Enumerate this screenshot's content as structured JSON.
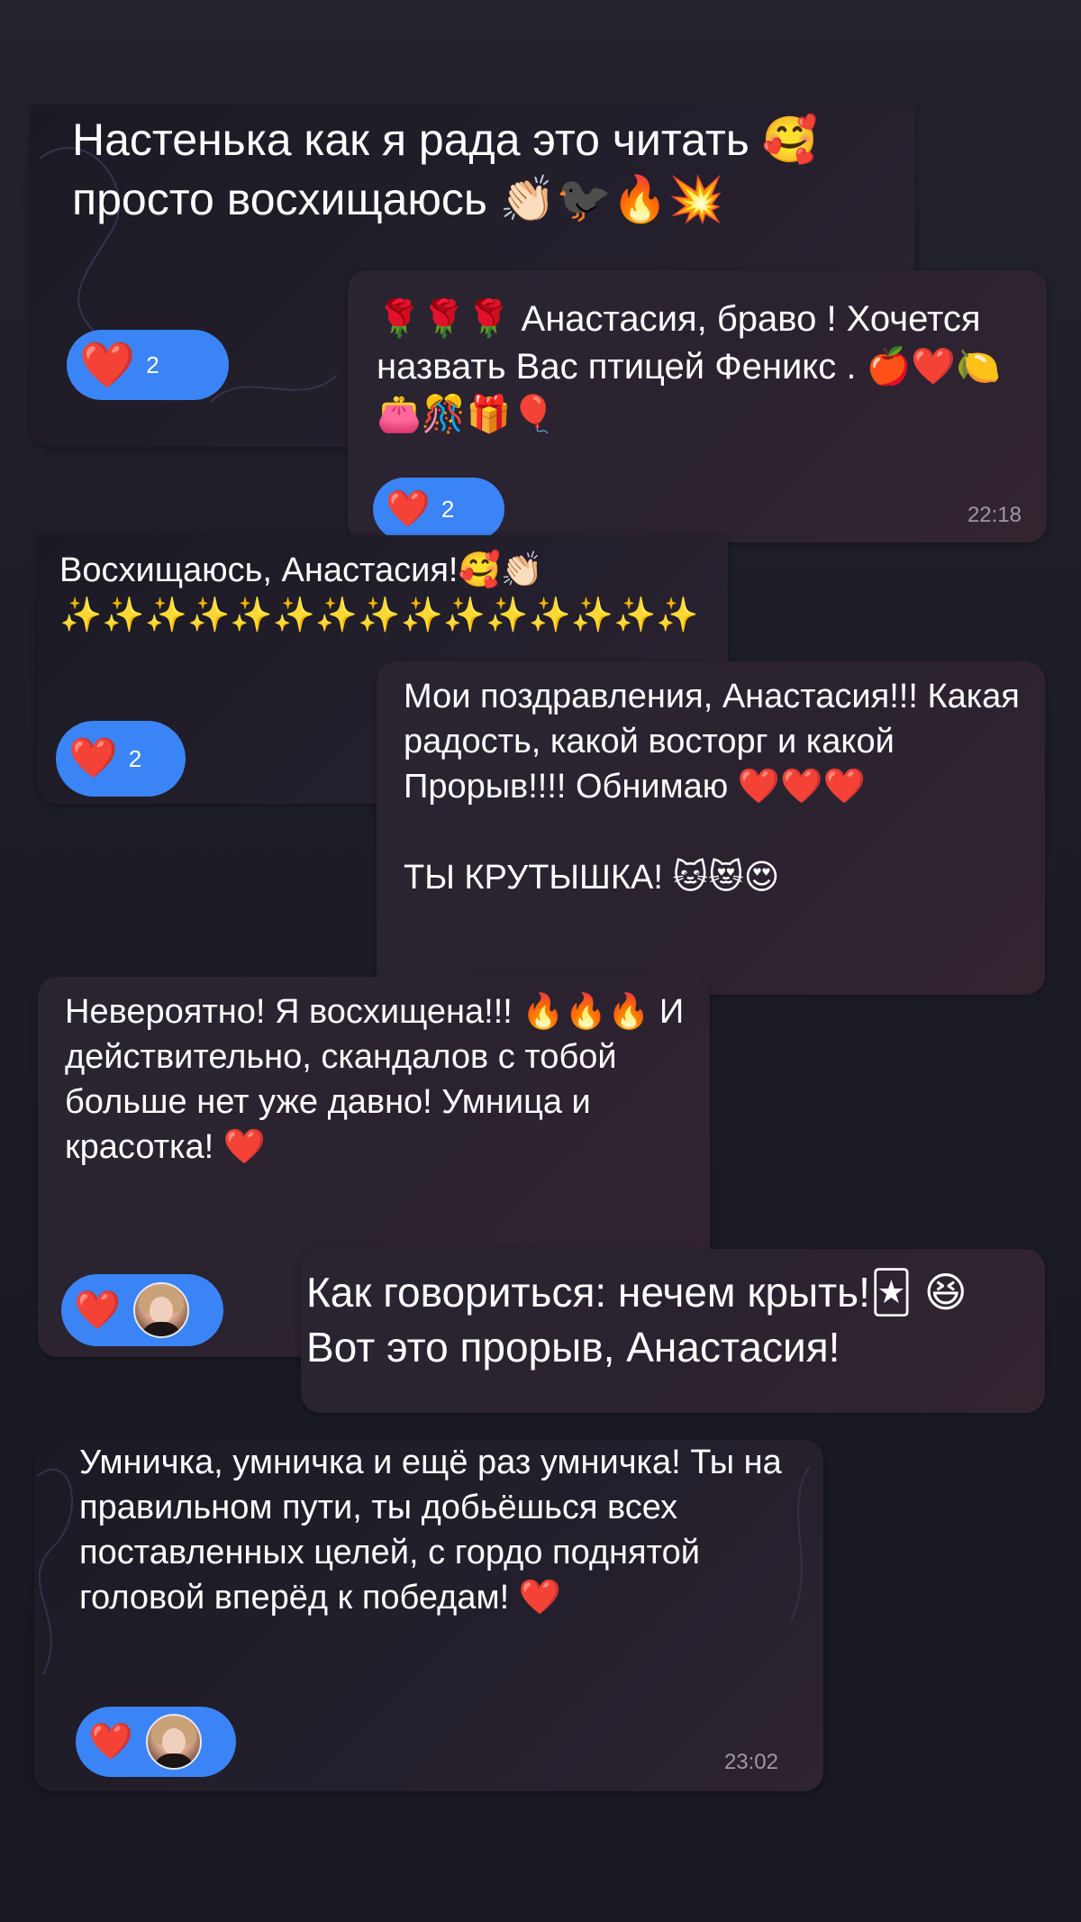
{
  "messages": [
    {
      "id": "m1",
      "text": "Настенька как я рада это читать 🥰 просто восхищаюсь 👏🏻🐦‍⬛🔥💥",
      "reaction": {
        "icon": "❤️",
        "count": "2"
      }
    },
    {
      "id": "m2",
      "text": "🌹🌹🌹 Анастасия, браво ! Хочется назвать Вас птицей Феникс . 🍎❤️🍋👛🎊🎁🎈",
      "reaction": {
        "icon": "❤️",
        "count": "2"
      },
      "time": "22:18"
    },
    {
      "id": "m3",
      "text": "Восхищаюсь, Анастасия!🥰👏🏻 ✨✨✨✨✨✨✨✨✨✨✨✨✨✨✨",
      "reaction": {
        "icon": "❤️",
        "count": "2"
      }
    },
    {
      "id": "m4",
      "text": "Мои поздравления, Анастасия!!! Какая радость, какой восторг и какой Прорыв!!!! Обнимаю ❤️❤️❤️\n\nТЫ КРУТЫШКА! 🐱😻😍"
    },
    {
      "id": "m5",
      "text": "Невероятно! Я восхищена!!! 🔥🔥🔥 И действительно, скандалов с тобой больше нет уже давно! Умница и красотка! ❤️",
      "reaction": {
        "icon": "❤️"
      }
    },
    {
      "id": "m6",
      "text": "Как говориться: нечем крыть!🃏 😆 Вот это прорыв, Анастасия!"
    },
    {
      "id": "m7",
      "text": "Умничка, умничка и ещё раз умничка! Ты на правильном пути, ты добьёшься всех поставленных целей, с гордо поднятой головой вперёд к победам! ❤️",
      "reaction": {
        "icon": "❤️"
      },
      "time": "23:02"
    }
  ],
  "colors": {
    "reaction_blue": "#3b84f5",
    "bubble": "#2b2230",
    "background": "#1d1d25",
    "timestamp": "#9d97a6"
  }
}
